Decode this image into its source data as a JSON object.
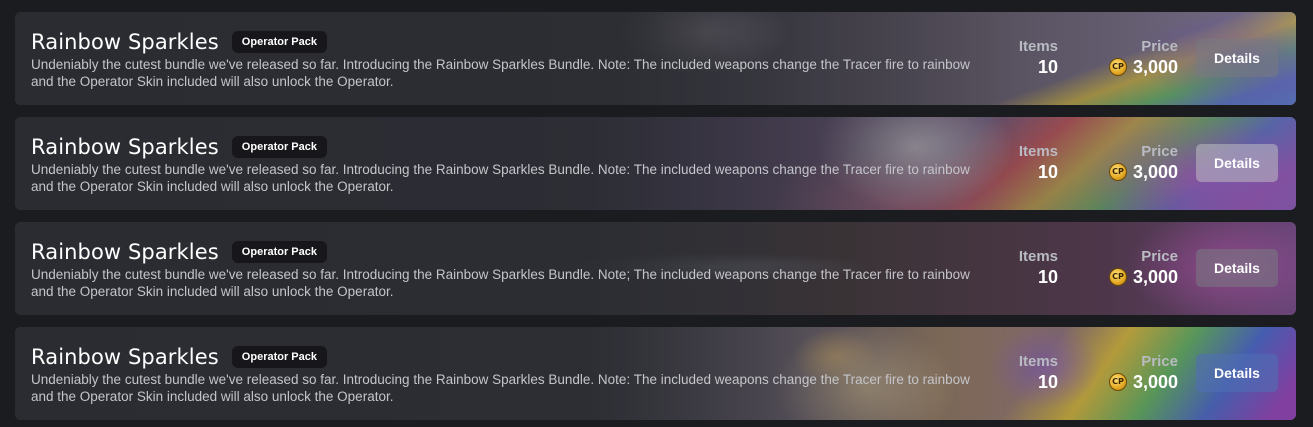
{
  "bundles": [
    {
      "title": "Rainbow Sparkles",
      "badge": "Operator Pack",
      "description": "Undeniably the cutest bundle we've released so far. Introducing the Rainbow Sparkles Bundle. Note: The included weapons change the Tracer fire to rainbow and the Operator Skin included will also unlock the Operator.",
      "items_label": "Items",
      "items_count": "10",
      "price_label": "Price",
      "price": "3,000",
      "currency_icon": "cp-coin-icon",
      "currency_text": "CP",
      "details_label": "Details"
    },
    {
      "title": "Rainbow Sparkles",
      "badge": "Operator Pack",
      "description": "Undeniably the cutest bundle we've released so far. Introducing the Rainbow Sparkles Bundle. Note: The included weapons change the Tracer fire to rainbow and the Operator Skin included will also unlock the Operator.",
      "items_label": "Items",
      "items_count": "10",
      "price_label": "Price",
      "price": "3,000",
      "currency_icon": "cp-coin-icon",
      "currency_text": "CP",
      "details_label": "Details"
    },
    {
      "title": "Rainbow Sparkles",
      "badge": "Operator Pack",
      "description": "Undeniably the cutest bundle we've released so far. Introducing the Rainbow Sparkles Bundle. Note; The included weapons change the Tracer fire to rainbow and the Operator Skin included will also unlock the Operator.",
      "items_label": "Items",
      "items_count": "10",
      "price_label": "Price",
      "price": "3,000",
      "currency_icon": "cp-coin-icon",
      "currency_text": "CP",
      "details_label": "Details"
    },
    {
      "title": "Rainbow Sparkles",
      "badge": "Operator Pack",
      "description": "Undeniably the cutest bundle we've released so far. Introducing the Rainbow Sparkles Bundle. Note: The included weapons change the Tracer fire to rainbow and the Operator Skin included will also unlock the Operator.",
      "items_label": "Items",
      "items_count": "10",
      "price_label": "Price",
      "price": "3,000",
      "currency_icon": "cp-coin-icon",
      "currency_text": "CP",
      "details_label": "Details"
    }
  ]
}
